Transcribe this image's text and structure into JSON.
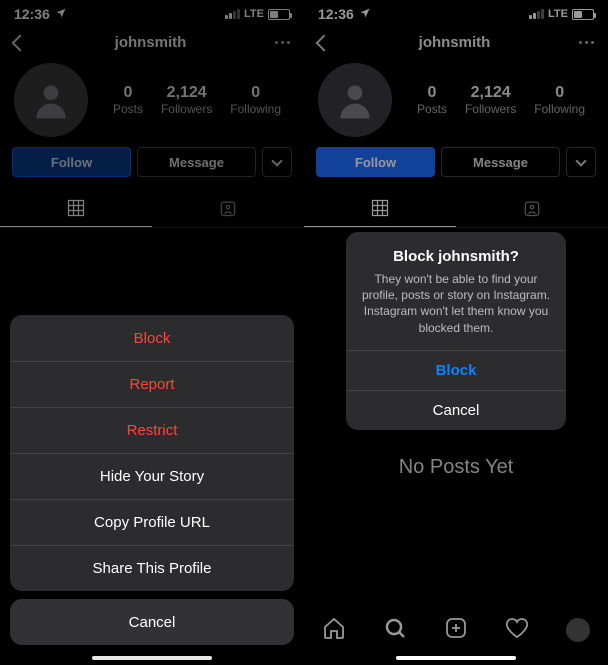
{
  "statusbar": {
    "time": "12:36",
    "network": "LTE"
  },
  "profile": {
    "username": "johnsmith",
    "stats": {
      "posts": {
        "count": "0",
        "label": "Posts"
      },
      "followers": {
        "count": "2,124",
        "label": "Followers"
      },
      "following": {
        "count": "0",
        "label": "Following"
      }
    },
    "follow_label": "Follow",
    "message_label": "Message"
  },
  "action_sheet": {
    "items": [
      {
        "label": "Block",
        "destructive": true
      },
      {
        "label": "Report",
        "destructive": true
      },
      {
        "label": "Restrict",
        "destructive": true
      },
      {
        "label": "Hide Your Story",
        "destructive": false
      },
      {
        "label": "Copy Profile URL",
        "destructive": false
      },
      {
        "label": "Share This Profile",
        "destructive": false
      }
    ],
    "cancel": "Cancel"
  },
  "block_alert": {
    "title": "Block johnsmith?",
    "body": "They won't be able to find your profile, posts or story on Instagram. Instagram won't let them know you blocked them.",
    "confirm": "Block",
    "cancel": "Cancel"
  },
  "empty_state": "No Posts Yet",
  "colors": {
    "accent_blue": "#1d6dff",
    "destructive_red": "#ff453a",
    "link_blue": "#0a84ff"
  }
}
